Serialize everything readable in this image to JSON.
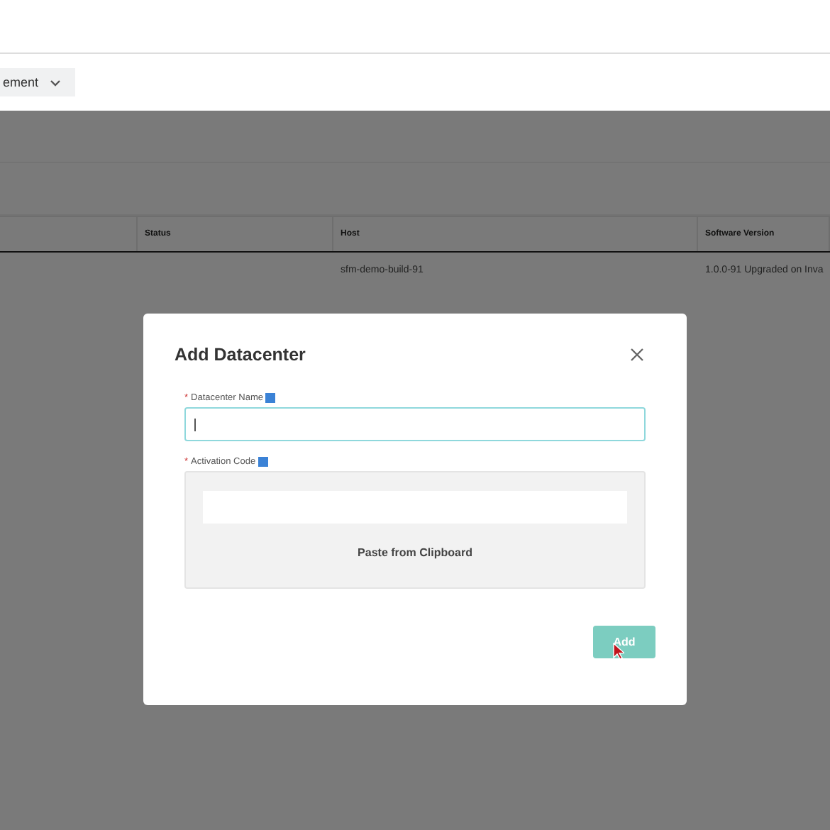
{
  "toolbar": {
    "dropdown": {
      "label": "ement"
    }
  },
  "table": {
    "columns": [
      "",
      "Status",
      "Host",
      "Software Version"
    ],
    "rows": [
      {
        "cells": [
          "",
          "",
          "sfm-demo-build-91",
          "1.0.0-91 Upgraded on Inva"
        ]
      }
    ]
  },
  "dialog": {
    "title": "Add Datacenter",
    "required_mark": "*",
    "fields": [
      {
        "kind": "text",
        "label": "Datacenter Name",
        "required": true,
        "focused": true
      },
      {
        "kind": "paste",
        "label": "Activation Code",
        "required": true,
        "action": "Paste from Clipboard"
      }
    ],
    "buttons": [
      {
        "label": "Add",
        "disabled": true
      }
    ]
  }
}
